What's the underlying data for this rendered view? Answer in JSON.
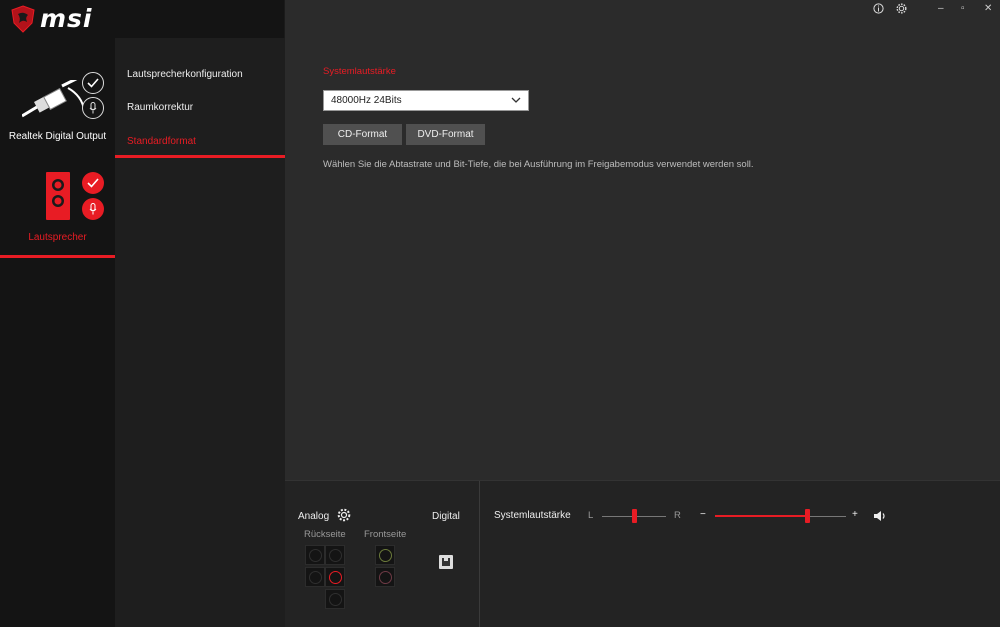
{
  "app": {
    "brand": "msi"
  },
  "window": {
    "info_icon": "info-icon",
    "settings_icon": "gear-icon",
    "minimize": "–",
    "maximize": "▫",
    "close": "✕"
  },
  "devices": [
    {
      "name": "Realtek Digital Output",
      "icon": "digital-plug-icon",
      "active": false
    },
    {
      "name": "Lautsprecher",
      "icon": "speaker-icon",
      "active": true
    }
  ],
  "menu": {
    "items": [
      {
        "label": "Lautsprecherkonfiguration"
      },
      {
        "label": "Raumkorrektur"
      },
      {
        "label": "Standardformat"
      }
    ],
    "active_index": 2
  },
  "main": {
    "section_title": "Systemlautstärke",
    "format_value": "48000Hz 24Bits",
    "cd_button": "CD-Format",
    "dvd_button": "DVD-Format",
    "description": "Wählen Sie die Abtastrate und Bit-Tiefe, die bei Ausführung im Freigabemodus verwendet werden soll."
  },
  "bottom": {
    "analog_label": "Analog",
    "rueckseite_label": "Rückseite",
    "frontseite_label": "Frontseite",
    "digital_label": "Digital",
    "volume_label": "Systemlautstärke",
    "balance_left": "L",
    "balance_right": "R",
    "minus": "−",
    "plus": "+",
    "balance_position": 0.5,
    "volume_level": 0.7
  },
  "colors": {
    "accent": "#e81c24",
    "background": "#2b2b2b",
    "sidebar": "#141414"
  }
}
